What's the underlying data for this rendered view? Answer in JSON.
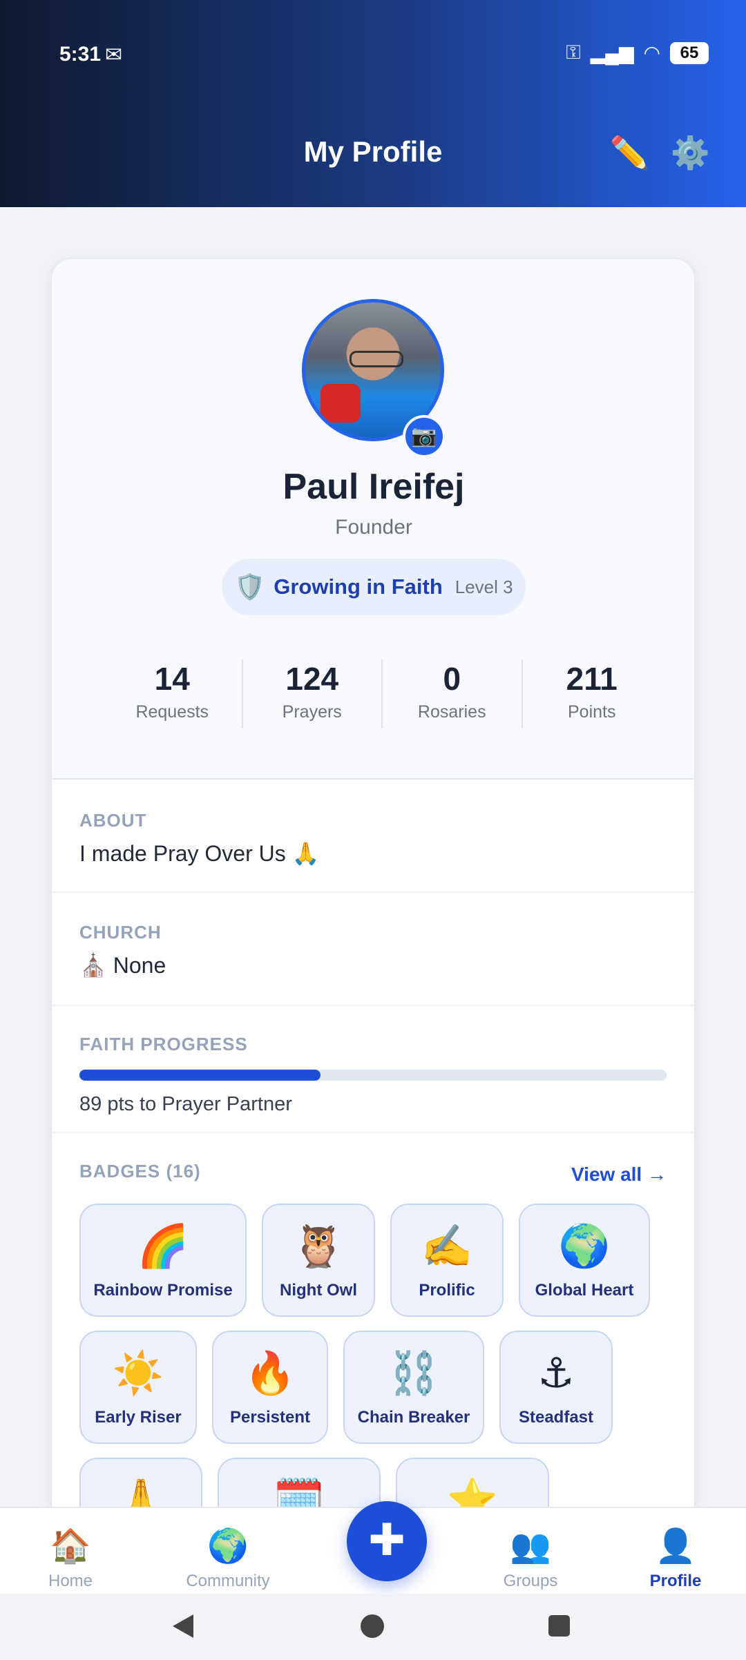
{
  "status_bar": {
    "time": "5:31",
    "mail_icon": "gmail-icon",
    "battery": "65"
  },
  "header": {
    "title": "My Profile",
    "edit_icon": "pencil-icon",
    "settings_icon": "gear-icon"
  },
  "profile": {
    "name": "Paul Ireifej",
    "role": "Founder",
    "level_name": "Growing in Faith",
    "level": "Level 3",
    "stats": [
      {
        "value": "14",
        "label": "Requests"
      },
      {
        "value": "124",
        "label": "Prayers"
      },
      {
        "value": "0",
        "label": "Rosaries"
      },
      {
        "value": "211",
        "label": "Points"
      }
    ]
  },
  "about": {
    "label": "ABOUT",
    "text": "I made Pray Over Us 🙏"
  },
  "church": {
    "label": "CHURCH",
    "text": "⛪ None"
  },
  "faith_progress": {
    "label": "FAITH PROGRESS",
    "progress_fraction": 0.41,
    "text": "89 pts to Prayer Partner"
  },
  "badges": {
    "label": "BADGES (16)",
    "view_all": "View all →",
    "items": [
      {
        "icon": "🌈",
        "name": "Rainbow Promise"
      },
      {
        "icon": "🦉",
        "name": "Night Owl"
      },
      {
        "icon": "✍️",
        "name": "Prolific"
      },
      {
        "icon": "🌍",
        "name": "Global Heart"
      },
      {
        "icon": "☀️",
        "name": "Early Riser"
      },
      {
        "icon": "🔥",
        "name": "Persistent"
      },
      {
        "icon": "⛓️",
        "name": "Chain Breaker"
      },
      {
        "icon": "⚓",
        "name": "Steadfast"
      },
      {
        "icon": "🙏",
        "name": ""
      },
      {
        "icon": "🗓️",
        "name": ""
      },
      {
        "icon": "⭐",
        "name": ""
      }
    ]
  },
  "bottom_nav": {
    "items": [
      {
        "icon": "🏠",
        "label": "Home"
      },
      {
        "icon": "🌍",
        "label": "Community"
      },
      {
        "icon": "👥",
        "label": "Groups"
      },
      {
        "icon": "👤",
        "label": "Profile"
      }
    ],
    "fab": "✚"
  }
}
